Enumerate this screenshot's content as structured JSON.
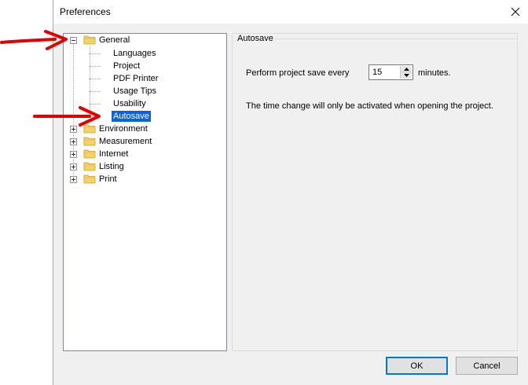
{
  "window": {
    "title": "Preferences"
  },
  "tree": {
    "items": [
      {
        "label": "General",
        "expanded": true,
        "children": [
          "Languages",
          "Project",
          "PDF Printer",
          "Usage Tips",
          "Usability",
          "Autosave"
        ]
      },
      {
        "label": "Environment",
        "expanded": false
      },
      {
        "label": "Measurement",
        "expanded": false
      },
      {
        "label": "Internet",
        "expanded": false
      },
      {
        "label": "Listing",
        "expanded": false
      },
      {
        "label": "Print",
        "expanded": false
      }
    ],
    "selected": "Autosave"
  },
  "panel": {
    "group_title": "Autosave",
    "save_label": "Perform project save every",
    "save_value": "15",
    "unit_label": "minutes.",
    "info_text": "The time change will only be activated when opening the project."
  },
  "buttons": {
    "ok": "OK",
    "cancel": "Cancel"
  },
  "colors": {
    "selection": "#0a64d8",
    "annotation_arrow": "#e00000",
    "folder": "#f5d16c"
  },
  "icons": {
    "close": "close-icon",
    "folder": "folder-icon",
    "annotation": "red-arrow-annotation"
  }
}
